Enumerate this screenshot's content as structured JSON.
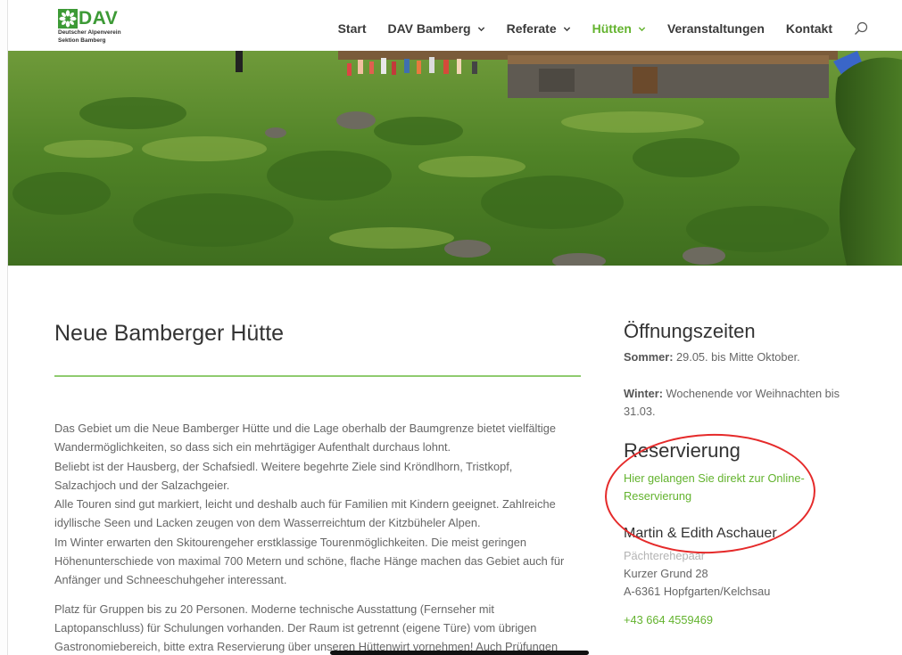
{
  "logo": {
    "name": "DAV",
    "line1": "Deutscher Alpenverein",
    "line2": "Sektion Bamberg",
    "color": "#3d9a36"
  },
  "nav": {
    "items": [
      {
        "label": "Start",
        "has_dropdown": false,
        "active": false
      },
      {
        "label": "DAV Bamberg",
        "has_dropdown": true,
        "active": false
      },
      {
        "label": "Referate",
        "has_dropdown": true,
        "active": false
      },
      {
        "label": "Hütten",
        "has_dropdown": true,
        "active": true
      },
      {
        "label": "Veranstaltungen",
        "has_dropdown": false,
        "active": false
      },
      {
        "label": "Kontakt",
        "has_dropdown": false,
        "active": false
      }
    ],
    "search_icon": "search-icon",
    "active_color": "#63b32e"
  },
  "main": {
    "title": "Neue Bamberger Hütte",
    "paragraph1_lines": [
      "Das Gebiet um die Neue Bamberger Hütte und die Lage oberhalb der Baumgrenze bietet vielfältige",
      "Wandermöglichkeiten, so dass sich ein mehrtägiger Aufenthalt durchaus lohnt.",
      "Beliebt ist der Hausberg, der Schafsiedl. Weitere begehrte Ziele sind Kröndlhorn, Tristkopf,",
      "Salzachjoch und der Salzachgeier.",
      "Alle Touren sind gut markiert, leicht und deshalb auch für Familien mit Kindern geeignet. Zahlreiche",
      "idyllische Seen und Lacken zeugen von dem Wasserreichtum der Kitzbüheler Alpen.",
      "Im Winter erwarten den Skitourengeher erstklassige Tourenmöglichkeiten. Die meist geringen",
      "Höhenunterschiede von maximal 700 Metern und schöne, flache Hänge machen das Gebiet auch für",
      "Anfänger und Schneeschuhgeher interessant."
    ],
    "paragraph2_lines": [
      "Platz für Gruppen bis zu 20 Personen. Moderne technische Ausstattung (Fernseher mit",
      "Laptopanschluss) für Schulungen vorhanden. Der Raum ist getrennt (eigene Türe) vom übrigen",
      "Gastronomiebereich, bitte extra Reservierung über unseren Hüttenwirt vornehmen! Auch Prüfungen"
    ]
  },
  "sidebar": {
    "opening_heading": "Öffnungszeiten",
    "summer_label": "Sommer:",
    "summer_value": " 29.05. bis Mitte Oktober.",
    "winter_label": "Winter:",
    "winter_value_line1": " Wochenende vor Weihnachten bis",
    "winter_value_line2": "31.03.",
    "reservation_heading": "Reservierung",
    "reservation_link_line1": "Hier gelangen Sie direkt zur Online-",
    "reservation_link_line2": "Reservierung",
    "hosts_name": "Martin & Edith Aschauer",
    "hosts_role": "Pächterehepaar",
    "address_line1": "Kurzer Grund 28",
    "address_line2": "A-6361 Hopfgarten/Kelchsau",
    "phone": "+43 664 4559469"
  },
  "annotation": {
    "shape": "ellipse",
    "color": "#e52a2a"
  }
}
